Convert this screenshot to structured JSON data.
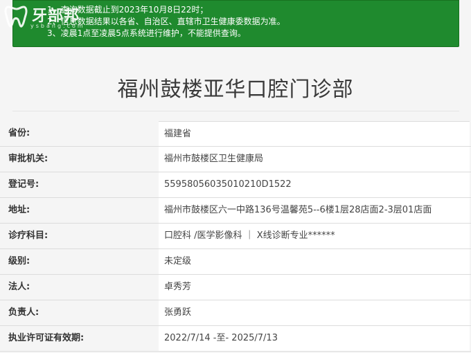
{
  "notice": {
    "lines": [
      "1、查询数据截止到2023年10月8日22时；",
      "2、信息数据结果以各省、自治区、直辖市卫生健康委数据为准。",
      "3、凌晨1点至凌晨5点系统进行维护，不能提供查询。"
    ]
  },
  "logo": {
    "text": "牙部邦",
    "sub": "ysbang.com"
  },
  "page": {
    "title": "福州鼓楼亚华口腔门诊部"
  },
  "details": [
    {
      "label": "省份:",
      "value": "福建省"
    },
    {
      "label": "审批机关:",
      "value": "福州市鼓楼区卫生健康局"
    },
    {
      "label": "登记号:",
      "value": "55958056035010210D1522"
    },
    {
      "label": "地址:",
      "value": "福州市鼓楼区六一中路136号温馨苑5--6楼1层28店面2-3层01店面"
    },
    {
      "label": "诊疗科目:",
      "value": "口腔科 /医学影像科 ｜ X线诊断专业******"
    },
    {
      "label": "级别:",
      "value": "未定级"
    },
    {
      "label": "法人:",
      "value": "卓秀芳"
    },
    {
      "label": "负责人:",
      "value": "张勇跃"
    },
    {
      "label": "执业许可证有效期:",
      "value": "2022/7/14 -至- 2025/7/13"
    }
  ],
  "colors": {
    "notice_bg": "#1f8a2e",
    "page_bg": "#f5f5f5"
  }
}
